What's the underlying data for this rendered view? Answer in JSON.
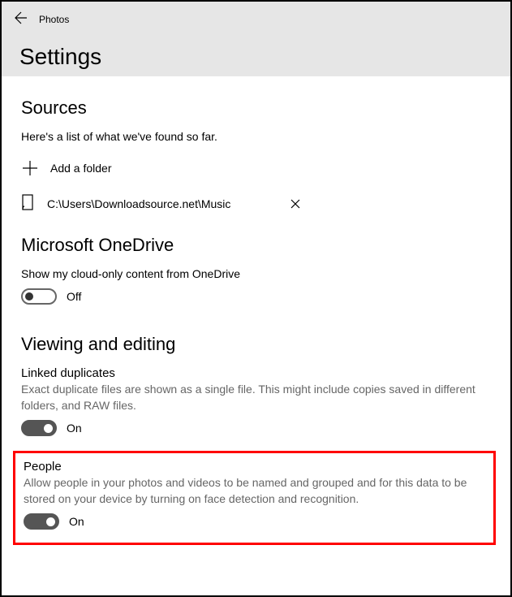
{
  "header": {
    "app_name": "Photos",
    "page_title": "Settings"
  },
  "sources": {
    "title": "Sources",
    "subtext": "Here's a list of what we've found so far.",
    "add_folder_label": "Add a folder",
    "items": [
      {
        "path": "C:\\Users\\Downloadsource.net\\Music"
      }
    ]
  },
  "onedrive": {
    "title": "Microsoft OneDrive",
    "desc": "Show my cloud-only content from OneDrive",
    "state_label": "Off"
  },
  "viewing": {
    "title": "Viewing and editing",
    "linked_duplicates": {
      "label": "Linked duplicates",
      "desc": "Exact duplicate files are shown as a single file. This might include copies saved in different folders, and RAW files.",
      "state_label": "On"
    },
    "people": {
      "label": "People",
      "desc": "Allow people in your photos and videos to be named and grouped and for this data to be stored on your device by turning on face detection and recognition.",
      "state_label": "On"
    }
  }
}
